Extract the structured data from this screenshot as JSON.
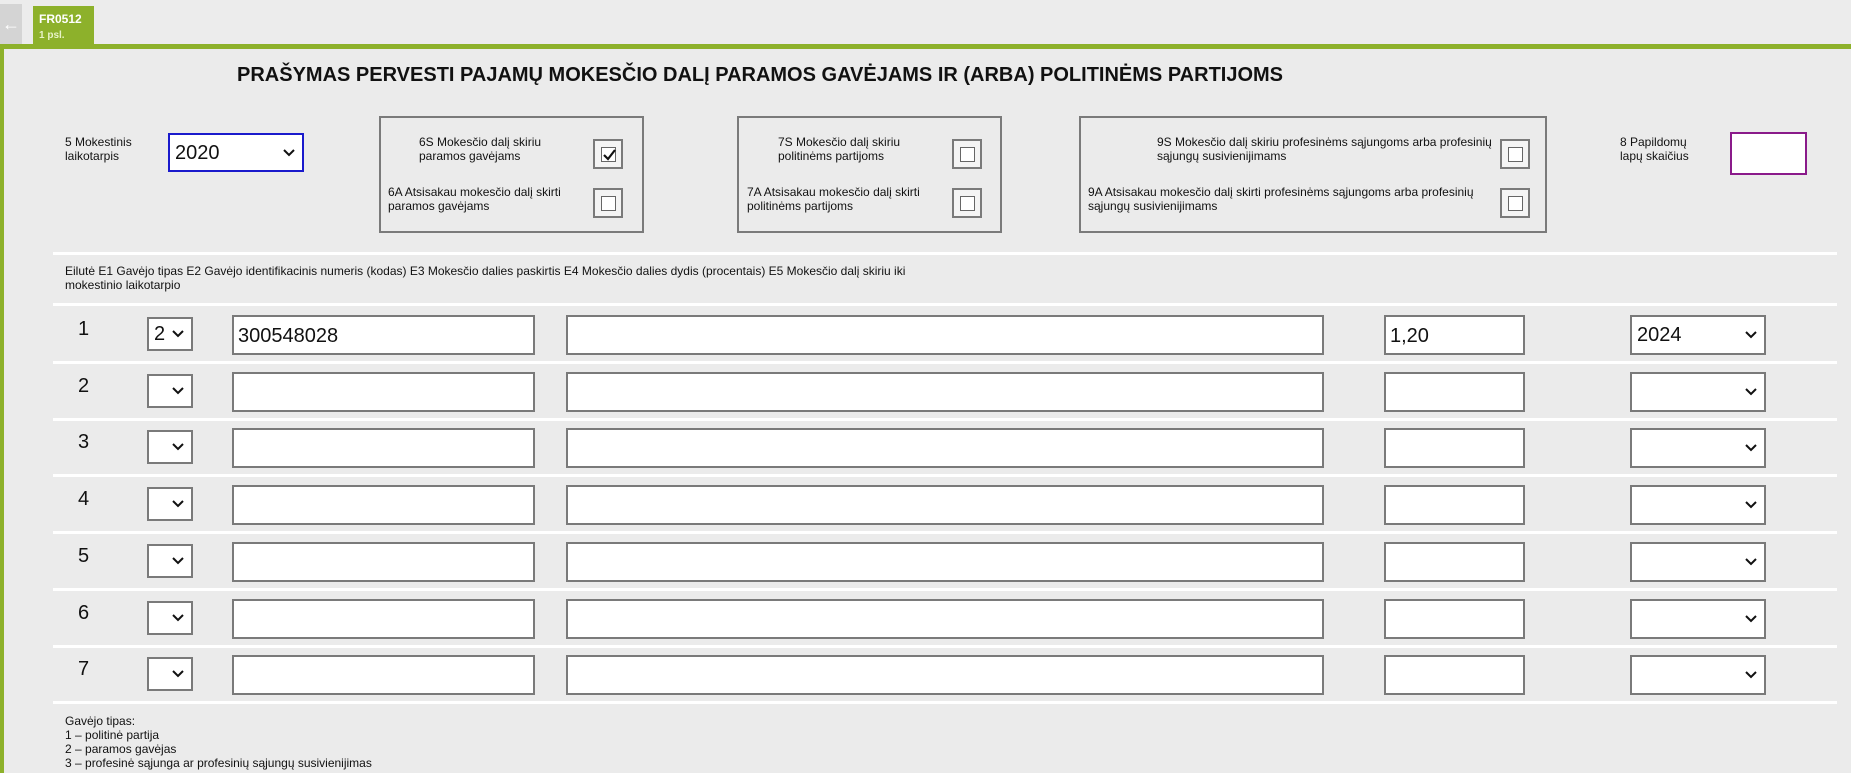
{
  "topbar": {
    "back_icon": "arrow-left-icon",
    "tab_code": "FR0512",
    "tab_page": "1 psl."
  },
  "form": {
    "title": "PRAŠYMAS PERVESTI PAJAMŲ MOKESČIO DALĮ PARAMOS GAVĖJAMS IR (ARBA) POLITINĖMS PARTIJOMS",
    "period_label_1": "5 Mokestinis",
    "period_label_2": "laikotarpis",
    "period_value": "2020",
    "group1": {
      "top_1": "6S Mokesčio dalį skiriu",
      "top_2": "paramos gavėjams",
      "top_checked": true,
      "bot_1": "6A Atsisakau mokesčio dalį skirti",
      "bot_2": "paramos gavėjams",
      "bot_checked": false
    },
    "group2": {
      "top_1": "7S Mokesčio dalį skiriu",
      "top_2": "politinėms partijoms",
      "top_checked": false,
      "bot_1": "7A Atsisakau mokesčio dalį skirti",
      "bot_2": "politinėms partijoms",
      "bot_checked": false
    },
    "group3": {
      "top_1": "9S Mokesčio dalį skiriu profesinėms sąjungoms arba profesinių",
      "top_2": "sąjungų susivienijimams",
      "top_checked": false,
      "bot_1": "9A Atsisakau mokesčio dalį skirti profesinėms sąjungoms arba profesinių",
      "bot_2": "sąjungų susivienijimams",
      "bot_checked": false
    },
    "pages_label_1": "8 Papildomų",
    "pages_label_2": "lapų skaičius",
    "pages_value": "",
    "columns_header_1": "Eilutė E1 Gavėjo tipas E2 Gavėjo identifikacinis numeris (kodas) E3 Mokesčio dalies paskirtis E4 Mokesčio dalies dydis (procentais) E5 Mokesčio dalį skiriu iki",
    "columns_header_2": "mokestinio laikotarpio",
    "rows": [
      {
        "num": "1",
        "type": "2",
        "code": "300548028",
        "purpose": "",
        "percent": "1,20",
        "year": "2024"
      },
      {
        "num": "2",
        "type": "",
        "code": "",
        "purpose": "",
        "percent": "",
        "year": ""
      },
      {
        "num": "3",
        "type": "",
        "code": "",
        "purpose": "",
        "percent": "",
        "year": ""
      },
      {
        "num": "4",
        "type": "",
        "code": "",
        "purpose": "",
        "percent": "",
        "year": ""
      },
      {
        "num": "5",
        "type": "",
        "code": "",
        "purpose": "",
        "percent": "",
        "year": ""
      },
      {
        "num": "6",
        "type": "",
        "code": "",
        "purpose": "",
        "percent": "",
        "year": ""
      },
      {
        "num": "7",
        "type": "",
        "code": "",
        "purpose": "",
        "percent": "",
        "year": ""
      }
    ],
    "legend_title": "Gavėjo tipas:",
    "legend_1": "1 – politinė partija",
    "legend_2": "2 – paramos gavėjas",
    "legend_3": "3 – profesinė sąjunga ar profesinių sąjungų susivienijimas"
  },
  "colors": {
    "accent": "#8db12b",
    "focus": "#1a1acc",
    "pages_border": "#8a1a8a"
  }
}
